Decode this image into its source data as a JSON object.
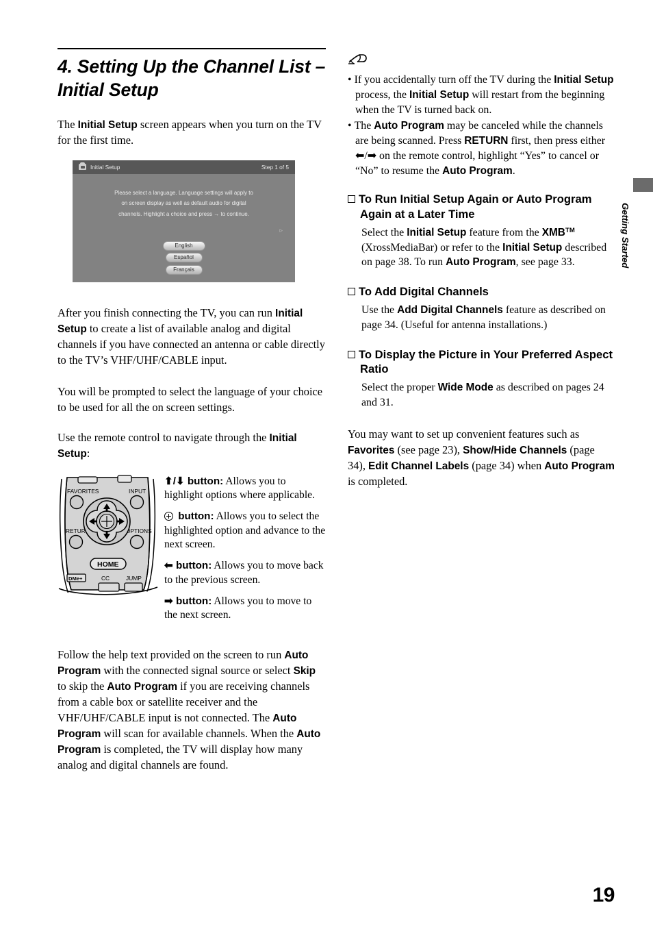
{
  "page": {
    "number": "19",
    "side_tab_label": "Getting Started"
  },
  "left": {
    "chapter_title": "4. Setting Up the Channel List – Initial Setup",
    "intro_pre": "The ",
    "intro_bold": "Initial Setup",
    "intro_post": " screen appears when you turn on the TV for the first time.",
    "para_after_connect": [
      {
        "t": "After you finish connecting the TV, you can run "
      },
      {
        "t": "Initial Setup",
        "b": true
      },
      {
        "t": " to create a list of available analog and digital channels if you have connected an antenna or cable directly to the TV’s VHF/UHF/CABLE input."
      }
    ],
    "para_language": [
      {
        "t": "You will be prompted to select the language of your choice to be used for all the on screen settings."
      }
    ],
    "para_use_remote": [
      {
        "t": "Use the remote control to navigate through the "
      },
      {
        "t": "Initial Setup",
        "b": true
      },
      {
        "t": ":"
      }
    ],
    "para_follow_help": [
      {
        "t": "Follow the help text provided on the screen to run "
      },
      {
        "t": "Auto Program",
        "b": true
      },
      {
        "t": " with the connected signal source or select "
      },
      {
        "t": "Skip",
        "b": true
      },
      {
        "t": " to skip the "
      },
      {
        "t": "Auto Program",
        "b": true
      },
      {
        "t": " if you are receiving channels from a cable box or satellite receiver and the VHF/UHF/CABLE input is not connected. The "
      },
      {
        "t": "Auto Program",
        "b": true
      },
      {
        "t": " will scan for available channels. When the "
      },
      {
        "t": "Auto Program",
        "b": true
      },
      {
        "t": " is completed, the TV will display how many analog and digital channels are found."
      }
    ],
    "tv_screen": {
      "title": "Initial Setup",
      "step": "Step 1 of 5",
      "message_lines": [
        "Please select a language. Language settings will apply to",
        "on screen display as well as default audio for digital",
        "channels.  Highlight a choice and press → to continue."
      ],
      "cursor_glyph": "▹",
      "languages": [
        "English",
        "Español",
        "Français"
      ],
      "selected_language": "English",
      "colors": {
        "header_bar": "#575757",
        "screen_body": "#828282",
        "text": "#eaeaea"
      }
    },
    "remote": {
      "labels": {
        "favorites": "FAVORITES",
        "input": "INPUT",
        "return": "RETURN",
        "options": "OPTIONS",
        "home": "HOME",
        "dme": "DMe+",
        "cc": "CC",
        "jump": "JUMP"
      }
    },
    "button_entries": [
      {
        "head_glyph": "⬆/⬇",
        "head_label": " button",
        "body": "Allows you to highlight options where applicable."
      },
      {
        "head_glyph": "ring",
        "head_label": " button",
        "body": "Allows you to select the highlighted option and advance to the next screen."
      },
      {
        "head_glyph": "⬅",
        "head_label": " button",
        "body": "Allows you to move back to the previous screen."
      },
      {
        "head_glyph": "➡",
        "head_label": " button",
        "body": "Allows you to move to the next screen."
      }
    ]
  },
  "right": {
    "note_icon": "note-pencil-icon",
    "notes": [
      [
        {
          "t": "If you accidentally turn off the TV during the "
        },
        {
          "t": "Initial Setup",
          "b": true
        },
        {
          "t": " process, the "
        },
        {
          "t": "Initial Setup",
          "b": true
        },
        {
          "t": " will restart from the beginning when the TV is turned back on."
        }
      ],
      [
        {
          "t": "The "
        },
        {
          "t": "Auto Program",
          "b": true
        },
        {
          "t": " may be canceled while the channels are being scanned. Press "
        },
        {
          "t": "RETURN",
          "b": true
        },
        {
          "t": " first, then press either ⬅/➡ on the remote control, highlight “Yes” to cancel or “No” to resume the "
        },
        {
          "t": "Auto Program",
          "b": true
        },
        {
          "t": "."
        }
      ]
    ],
    "sections": [
      {
        "heading": "To Run Initial Setup Again or Auto Program Again at a Later Time",
        "body": [
          {
            "t": "Select the "
          },
          {
            "t": "Initial Setup",
            "b": true
          },
          {
            "t": " feature from the "
          },
          {
            "t": "XMB",
            "b": true
          },
          {
            "t": "TM",
            "sup": true
          },
          {
            "t": " (XrossMediaBar) or refer to the "
          },
          {
            "t": "Initial Setup",
            "b": true
          },
          {
            "t": " described on page 38. To run "
          },
          {
            "t": "Auto Program",
            "b": true
          },
          {
            "t": ", see page 33."
          }
        ]
      },
      {
        "heading": "To Add Digital Channels",
        "body": [
          {
            "t": "Use the "
          },
          {
            "t": "Add Digital Channels",
            "b": true
          },
          {
            "t": " feature as described on page 34. (Useful for antenna installations.)"
          }
        ]
      },
      {
        "heading": "To Display the Picture in Your Preferred Aspect Ratio",
        "body": [
          {
            "t": "Select the proper "
          },
          {
            "t": "Wide Mode",
            "b": true
          },
          {
            "t": " as described on pages 24 and 31."
          }
        ]
      }
    ],
    "closing_para": [
      {
        "t": "You may want to set up convenient features such as "
      },
      {
        "t": "Favorites",
        "b": true
      },
      {
        "t": " (see page 23), "
      },
      {
        "t": "Show/Hide Channels",
        "b": true
      },
      {
        "t": " (page 34), "
      },
      {
        "t": "Edit Channel Labels",
        "b": true
      },
      {
        "t": " (page 34) when "
      },
      {
        "t": "Auto Program",
        "b": true
      },
      {
        "t": " is completed."
      }
    ]
  }
}
